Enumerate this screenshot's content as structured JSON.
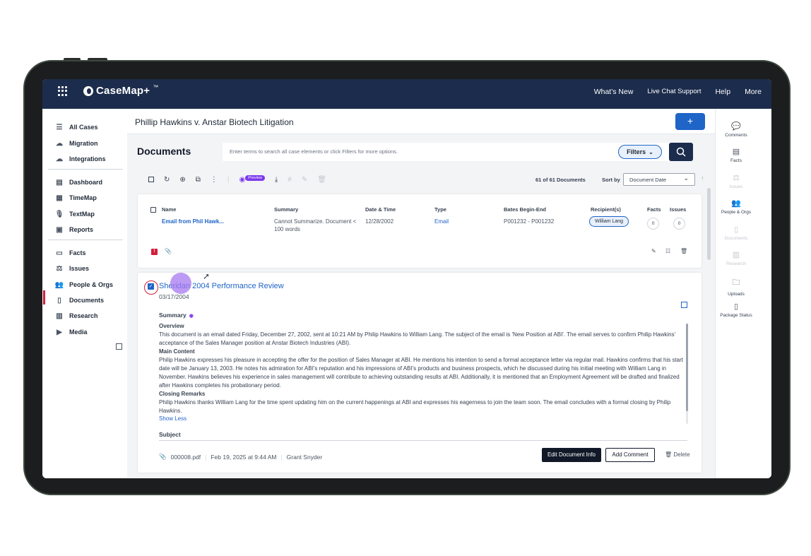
{
  "app": {
    "name": "CaseMap+",
    "superscript": "™"
  },
  "topnav": {
    "links": [
      "What's New",
      "Live Chat Support",
      "Help",
      "More"
    ]
  },
  "sidebar": {
    "items": [
      {
        "label": "All Cases",
        "icon": "list-icon"
      },
      {
        "label": "Migration",
        "icon": "cloud-icon"
      },
      {
        "label": "Integrations",
        "icon": "cloud-icon"
      },
      {
        "label": "Dashboard",
        "icon": "dashboard-icon"
      },
      {
        "label": "TimeMap",
        "icon": "timemap-icon"
      },
      {
        "label": "TextMap",
        "icon": "microphone-icon"
      },
      {
        "label": "Reports",
        "icon": "reports-icon"
      },
      {
        "label": "Facts",
        "icon": "facts-icon"
      },
      {
        "label": "Issues",
        "icon": "issues-icon"
      },
      {
        "label": "People & Orgs",
        "icon": "people-icon"
      },
      {
        "label": "Documents",
        "icon": "documents-icon"
      },
      {
        "label": "Research",
        "icon": "research-icon"
      },
      {
        "label": "Media",
        "icon": "play-icon"
      }
    ],
    "active": "Documents"
  },
  "case": {
    "title": "Phillip Hawkins v. Anstar Biotech Litigation",
    "add_label": "+"
  },
  "documents": {
    "title": "Documents",
    "search_placeholder": "Enter terms to search all case elements or click Filters for more options.",
    "filters_label": "Filters",
    "preview_label": "Preview",
    "count_label": "61 of 61 Documents",
    "sort_label": "Sort by",
    "sort_value": "Document Date"
  },
  "table": {
    "headers": [
      "Name",
      "Summary",
      "Date & Time",
      "Type",
      "Bates Begin-End",
      "Recipient(s)",
      "Facts",
      "Issues"
    ],
    "row": {
      "name": "Email from Phil Hawk...",
      "summary": "Cannot Summarize. Document < 100 words",
      "date": "12/28/2002",
      "type": "Email",
      "bates": "P001232 - P001232",
      "recipient": "William Lang",
      "facts": "0",
      "issues": "0",
      "flag": "!"
    }
  },
  "detail": {
    "title": "Sheridan 2004 Performance Review",
    "date": "03/17/2004",
    "summary_label": "Summary",
    "overview_heading": "Overview",
    "overview_text": "This document is an email dated Friday, December 27, 2002, sent at 10:21 AM by Philip Hawkins to William Lang. The subject of the email is 'New Position at ABI'. The email serves to confirm Philip Hawkins' acceptance of the Sales Manager position at Anstar Biotech Industries (ABI).",
    "main_heading": "Main Content",
    "main_text": "Philip Hawkins expresses his pleasure in accepting the offer for the position of Sales Manager at ABI. He mentions his intention to send a formal acceptance letter via regular mail. Hawkins confirms that his start date will be January 13, 2003. He notes his admiration for ABI's reputation and his impressions of ABI's products and business prospects, which he discussed during his initial meeting with William Lang in November. Hawkins believes his experience in sales management will contribute to achieving outstanding results at ABI. Additionally, it is mentioned that an Employment Agreement will be drafted and finalized after Hawkins completes his probationary period.",
    "closing_heading": "Closing Remarks",
    "closing_text": "Philip Hawkins thanks William Lang for the time spent updating him on the current happenings at ABI and expresses his eagerness to join the team soon. The email concludes with a formal closing by Philip Hawkins.",
    "show_less": "Show Less",
    "subject_label": "Subject",
    "file_name": "000008.pdf",
    "timestamp": "Feb 19, 2025 at 9:44 AM",
    "author": "Grant Snyder",
    "edit_label": "Edit Document Info",
    "comment_label": "Add Comment",
    "delete_label": "Delete"
  },
  "rightrail": {
    "items": [
      {
        "label": "Comments",
        "enabled": true
      },
      {
        "label": "Facts",
        "enabled": true
      },
      {
        "label": "Issues",
        "enabled": false
      },
      {
        "label": "People & Orgs",
        "enabled": true
      },
      {
        "label": "Documents",
        "enabled": false
      },
      {
        "label": "Research",
        "enabled": false
      },
      {
        "label": "Uploads",
        "enabled": true
      },
      {
        "label": "Package Status",
        "enabled": true
      }
    ]
  },
  "colors": {
    "nav": "#1c2c4c",
    "accent": "#1f64c7",
    "active": "#d21f3c",
    "preview": "#7c3aed"
  }
}
